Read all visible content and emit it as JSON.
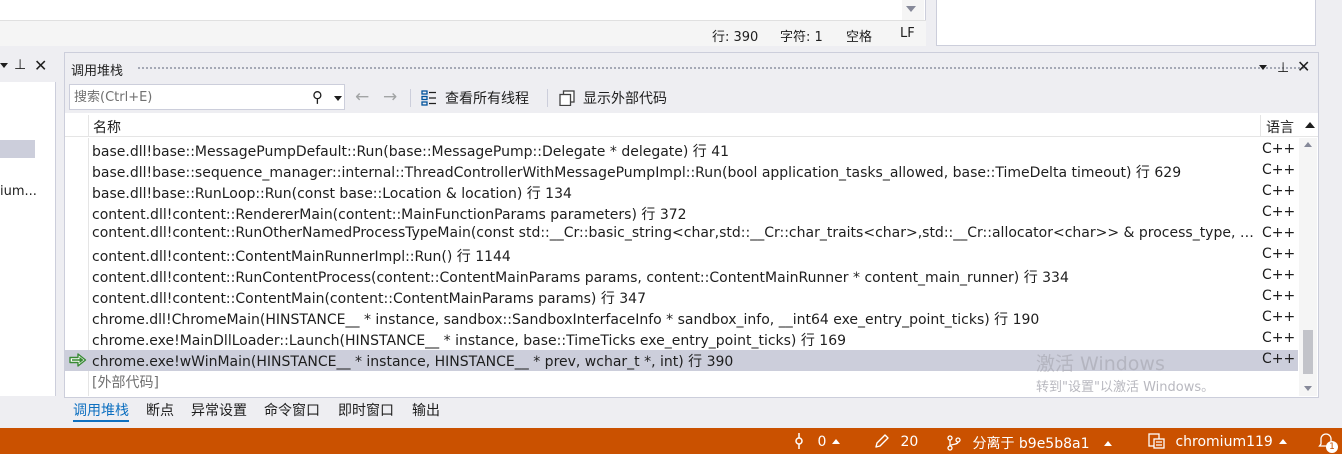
{
  "editor": {
    "status": {
      "line": "行: 390",
      "char": "字符: 1",
      "whitespace": "空格",
      "line_ending": "LF"
    }
  },
  "left_pane": {
    "truncated_text": "ium..."
  },
  "call_stack": {
    "title": "调用堆栈",
    "search_placeholder": "搜索(Ctrl+E)",
    "view_all_threads": "查看所有线程",
    "show_external_code": "显示外部代码",
    "columns": {
      "name": "名称",
      "language": "语言"
    },
    "rows": [
      {
        "name": "base.dll!base::MessagePumpDefault::Run(base::MessagePump::Delegate * delegate) 行 41",
        "lang": "C++",
        "current": false
      },
      {
        "name": "base.dll!base::sequence_manager::internal::ThreadControllerWithMessagePumpImpl::Run(bool application_tasks_allowed, base::TimeDelta timeout) 行 629",
        "lang": "C++",
        "current": false
      },
      {
        "name": "base.dll!base::RunLoop::Run(const base::Location & location) 行 134",
        "lang": "C++",
        "current": false
      },
      {
        "name": "content.dll!content::RendererMain(content::MainFunctionParams parameters) 行 372",
        "lang": "C++",
        "current": false
      },
      {
        "name": "content.dll!content::RunOtherNamedProcessTypeMain(const std::__Cr::basic_string<char,std::__Cr::char_traits<char>,std::__Cr::allocator<char>> & process_type, content::MainFunc...",
        "lang": "C++",
        "current": false
      },
      {
        "name": "content.dll!content::ContentMainRunnerImpl::Run() 行 1144",
        "lang": "C++",
        "current": false
      },
      {
        "name": "content.dll!content::RunContentProcess(content::ContentMainParams params, content::ContentMainRunner * content_main_runner) 行 334",
        "lang": "C++",
        "current": false
      },
      {
        "name": "content.dll!content::ContentMain(content::ContentMainParams params) 行 347",
        "lang": "C++",
        "current": false
      },
      {
        "name": "chrome.dll!ChromeMain(HINSTANCE__ * instance, sandbox::SandboxInterfaceInfo * sandbox_info, __int64 exe_entry_point_ticks) 行 190",
        "lang": "C++",
        "current": false
      },
      {
        "name": "chrome.exe!MainDllLoader::Launch(HINSTANCE__ * instance, base::TimeTicks exe_entry_point_ticks) 行 169",
        "lang": "C++",
        "current": false
      },
      {
        "name": "chrome.exe!wWinMain(HINSTANCE__ * instance, HINSTANCE__ * prev, wchar_t *, int) 行 390",
        "lang": "C++",
        "current": true
      },
      {
        "name": "[外部代码]",
        "lang": "",
        "current": false,
        "external": true
      }
    ]
  },
  "watermark": {
    "line1": "激活 Windows",
    "line2": "转到\"设置\"以激活 Windows。"
  },
  "bottom_tabs": [
    "调用堆栈",
    "断点",
    "异常设置",
    "命令窗口",
    "即时窗口",
    "输出"
  ],
  "statusbar": {
    "push_count": "0",
    "edit_count": "20",
    "branch": "分离于 b9e5b8a1",
    "repo": "chromium119",
    "notification_badge": "1"
  },
  "colors": {
    "statusbar_bg": "#ca5100",
    "active_tab": "#0e70c0",
    "current_row": "#cccedb"
  }
}
